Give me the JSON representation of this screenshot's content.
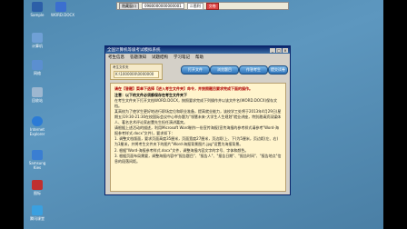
{
  "desktop_icons": [
    {
      "label": "Sample",
      "color": "#2c5fa8"
    },
    {
      "label": "WORD.DOCX",
      "color": "#3b6fcf"
    },
    {
      "label": "计算机",
      "color": "#6fa0d6"
    },
    {
      "label": "网络",
      "color": "#5b8fd0"
    },
    {
      "label": "回收站",
      "color": "#9db7d0"
    },
    {
      "label": "Internet Explorer",
      "color": "#2b7bd6"
    },
    {
      "label": "Samsung Kies",
      "color": "#3a7ed2"
    },
    {
      "label": "图标",
      "color": "#c03030"
    },
    {
      "label": "腾讯课堂",
      "color": "#3aa0e0"
    }
  ],
  "floatbar": {
    "hide_label": "隐藏窗口",
    "exam_id": "0980000000000001",
    "user": "二思利",
    "status": "",
    "close_label": "交卷"
  },
  "window": {
    "title": "全国计算机等级考试模拟系统",
    "menu": [
      "考生信息",
      "答题须知",
      "试题结构",
      "学习笔记",
      "帮助"
    ],
    "exam_card_label": "考生文件夹",
    "exam_card_value": "K:\\1000000\\0000000",
    "tool_buttons": [
      "打开文件",
      "浏览题目",
      "作答考生",
      "提交试卷"
    ]
  },
  "content": {
    "instruction_red": "请在【答题】菜单下选择【进入考生文件夹】命令，并按照题目要求完成下面的操作。",
    "note": "注意：以下的文件必须都保存在考生文件夹下",
    "paragraphs": [
      "在考生文件夹下打开文档WORD.DOCX，按照要求完成下列操作并以该文件名(WORD.DOCX)保存文档。",
      "某高校为了使学生更好地进行职场定位和职业准备，提高就业能力，该校学工处将于2013年4月29日(星期五)19:30-21:30在校国际会议中心举办题为\"领慧未来-大学生人生规划\"就业讲座，特别邀请资深媒体人、著名艺术评论家赵蕈先生担任演讲嘉宾。",
      "请根据上述活动的描述，利用Microsoft Word制作一份宣传海报(宣传海报的参考样式请参考\"Word-海报参考样式.docx\"文件)，要求如下：",
      "1. 调整文档版面，要求页面高度35厘米，页面宽度27厘米，页边距(上、下)为5厘米，页边距(左、右)为3厘米，并将考生文件夹下的图片\"Word-海报背景图片.jpg\"设置为海报背景。",
      "2. 根据\"Word-海报参考样式.docx\"文件，调整海报内容文字的字号、字体和颜色。",
      "3. 根据页面布局需要，调整海报内容中\"报告题目\"、\"报告人\"、\"报告日期\"、\"报告时间\"、\"报告地点\"信息的段落间距。"
    ]
  }
}
